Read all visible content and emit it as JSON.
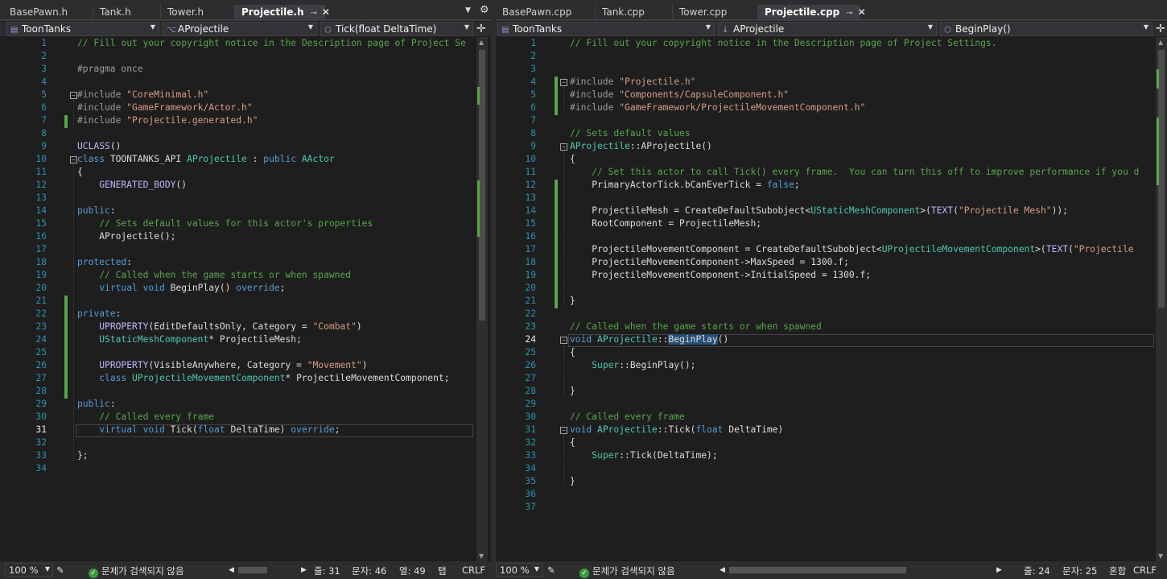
{
  "left": {
    "tabs": [
      {
        "label": "BasePawn.h",
        "active": false
      },
      {
        "label": "Tank.h",
        "active": false
      },
      {
        "label": "Tower.h",
        "active": false
      },
      {
        "label": "Projectile.h",
        "active": true
      }
    ],
    "nav": {
      "project": "ToonTanks",
      "class": "AProjectile",
      "member": "Tick(float DeltaTime)"
    },
    "status": {
      "zoom": "100 %",
      "issues": "문제가 검색되지 않음",
      "line": "줄: 31",
      "char": "문자: 46",
      "col": "열: 49",
      "indent": "탭",
      "eol": "CRLF"
    },
    "current_line": 31
  },
  "right": {
    "tabs": [
      {
        "label": "BasePawn.cpp",
        "active": false
      },
      {
        "label": "Tank.cpp",
        "active": false
      },
      {
        "label": "Tower.cpp",
        "active": false
      },
      {
        "label": "Projectile.cpp",
        "active": true
      }
    ],
    "nav": {
      "project": "ToonTanks",
      "class": "AProjectile",
      "member": "BeginPlay()"
    },
    "status": {
      "zoom": "100 %",
      "issues": "문제가 검색되지 않음",
      "line": "줄: 24",
      "char": "문자: 25",
      "indent": "혼합",
      "eol": "CRLF"
    },
    "current_line": 24
  },
  "left_code": [
    [
      [
        "cmt",
        "// Fill out your copyright notice in the Description page of Project Se"
      ]
    ],
    [],
    [
      [
        "pp",
        "#pragma once"
      ]
    ],
    [],
    [
      [
        "pp",
        "#include "
      ],
      [
        "str",
        "\"CoreMinimal.h\""
      ]
    ],
    [
      [
        "pp",
        "#include "
      ],
      [
        "str",
        "\"GameFramework/Actor.h\""
      ]
    ],
    [
      [
        "pp",
        "#include "
      ],
      [
        "str",
        "\"Projectile.generated.h\""
      ]
    ],
    [],
    [
      [
        "mac",
        "UCLASS"
      ],
      [
        "plain",
        "()"
      ]
    ],
    [
      [
        "kw",
        "class "
      ],
      [
        "plain",
        "TOONTANKS_API "
      ],
      [
        "typ",
        "AProjectile"
      ],
      [
        "plain",
        " : "
      ],
      [
        "kw",
        "public "
      ],
      [
        "typ",
        "AActor"
      ]
    ],
    [
      [
        "plain",
        "{"
      ]
    ],
    [
      [
        "plain",
        "    "
      ],
      [
        "mac",
        "GENERATED_BODY"
      ],
      [
        "plain",
        "()"
      ]
    ],
    [],
    [
      [
        "kw",
        "public"
      ],
      [
        "plain",
        ":"
      ]
    ],
    [
      [
        "plain",
        "    "
      ],
      [
        "cmt",
        "// Sets default values for this actor's properties"
      ]
    ],
    [
      [
        "plain",
        "    AProjectile();"
      ]
    ],
    [],
    [
      [
        "kw",
        "protected"
      ],
      [
        "plain",
        ":"
      ]
    ],
    [
      [
        "plain",
        "    "
      ],
      [
        "cmt",
        "// Called when the game starts or when spawned"
      ]
    ],
    [
      [
        "plain",
        "    "
      ],
      [
        "kw",
        "virtual void "
      ],
      [
        "plain",
        "BeginPlay() "
      ],
      [
        "kw",
        "override"
      ],
      [
        "plain",
        ";"
      ]
    ],
    [],
    [
      [
        "kw",
        "private"
      ],
      [
        "plain",
        ":"
      ]
    ],
    [
      [
        "plain",
        "    "
      ],
      [
        "mac",
        "UPROPERTY"
      ],
      [
        "plain",
        "(EditDefaultsOnly, Category = "
      ],
      [
        "str",
        "\"Combat\""
      ],
      [
        "plain",
        ")"
      ]
    ],
    [
      [
        "plain",
        "    "
      ],
      [
        "typ",
        "UStaticMeshComponent"
      ],
      [
        "plain",
        "* ProjectileMesh;"
      ]
    ],
    [],
    [
      [
        "plain",
        "    "
      ],
      [
        "mac",
        "UPROPERTY"
      ],
      [
        "plain",
        "(VisibleAnywhere, Category = "
      ],
      [
        "str",
        "\"Movement\""
      ],
      [
        "plain",
        ")"
      ]
    ],
    [
      [
        "plain",
        "    "
      ],
      [
        "kw",
        "class "
      ],
      [
        "typ",
        "UProjectileMovementComponent"
      ],
      [
        "plain",
        "* ProjectileMovementComponent;"
      ]
    ],
    [],
    [
      [
        "kw",
        "public"
      ],
      [
        "plain",
        ":"
      ]
    ],
    [
      [
        "plain",
        "    "
      ],
      [
        "cmt",
        "// Called every frame"
      ]
    ],
    [
      [
        "plain",
        "    "
      ],
      [
        "kw",
        "virtual void "
      ],
      [
        "plain",
        "Tick("
      ],
      [
        "kw",
        "float "
      ],
      [
        "plain",
        "DeltaTime) "
      ],
      [
        "kw",
        "override"
      ],
      [
        "plain",
        ";"
      ]
    ],
    [],
    [
      [
        "plain",
        "};"
      ]
    ],
    []
  ],
  "right_code": [
    [
      [
        "cmt",
        "// Fill out your copyright notice in the Description page of Project Settings."
      ]
    ],
    [],
    [],
    [
      [
        "pp",
        "#include "
      ],
      [
        "str",
        "\"Projectile.h\""
      ]
    ],
    [
      [
        "pp",
        "#include "
      ],
      [
        "str",
        "\"Components/CapsuleComponent.h\""
      ]
    ],
    [
      [
        "pp",
        "#include "
      ],
      [
        "str",
        "\"GameFramework/ProjectileMovementComponent.h\""
      ]
    ],
    [],
    [
      [
        "cmt",
        "// Sets default values"
      ]
    ],
    [
      [
        "typ",
        "AProjectile"
      ],
      [
        "plain",
        "::"
      ],
      [
        "plain",
        "AProjectile()"
      ]
    ],
    [
      [
        "plain",
        "{"
      ]
    ],
    [
      [
        "plain",
        "    "
      ],
      [
        "cmt",
        "// Set this actor to call Tick() every frame.  You can turn this off to improve performance if you d"
      ]
    ],
    [
      [
        "plain",
        "    PrimaryActorTick.bCanEverTick = "
      ],
      [
        "kw",
        "false"
      ],
      [
        "plain",
        ";"
      ]
    ],
    [],
    [
      [
        "plain",
        "    ProjectileMesh = CreateDefaultSubobject<"
      ],
      [
        "typ",
        "UStaticMeshComponent"
      ],
      [
        "plain",
        ">("
      ],
      [
        "mac",
        "TEXT"
      ],
      [
        "plain",
        "("
      ],
      [
        "str",
        "\"Projectile Mesh\""
      ],
      [
        "plain",
        "));"
      ]
    ],
    [
      [
        "plain",
        "    RootComponent = ProjectileMesh;"
      ]
    ],
    [],
    [
      [
        "plain",
        "    ProjectileMovementComponent = CreateDefaultSubobject<"
      ],
      [
        "typ",
        "UProjectileMovementComponent"
      ],
      [
        "plain",
        ">("
      ],
      [
        "mac",
        "TEXT"
      ],
      [
        "plain",
        "("
      ],
      [
        "str",
        "\"Projectile"
      ]
    ],
    [
      [
        "plain",
        "    ProjectileMovementComponent->MaxSpeed = 1300.f;"
      ]
    ],
    [
      [
        "plain",
        "    ProjectileMovementComponent->InitialSpeed = 1300.f;"
      ]
    ],
    [],
    [
      [
        "plain",
        "}"
      ]
    ],
    [],
    [
      [
        "cmt",
        "// Called when the game starts or when spawned"
      ]
    ],
    [
      [
        "kw",
        "void "
      ],
      [
        "typ",
        "AProjectile"
      ],
      [
        "plain",
        "::"
      ],
      [
        "sel",
        "BeginPlay"
      ],
      [
        "plain",
        "()"
      ]
    ],
    [
      [
        "plain",
        "{"
      ]
    ],
    [
      [
        "plain",
        "    "
      ],
      [
        "typ",
        "Super"
      ],
      [
        "plain",
        "::BeginPlay();"
      ]
    ],
    [],
    [
      [
        "plain",
        "}"
      ]
    ],
    [],
    [
      [
        "cmt",
        "// Called every frame"
      ]
    ],
    [
      [
        "kw",
        "void "
      ],
      [
        "typ",
        "AProjectile"
      ],
      [
        "plain",
        "::Tick("
      ],
      [
        "kw",
        "float "
      ],
      [
        "plain",
        "DeltaTime)"
      ]
    ],
    [
      [
        "plain",
        "{"
      ]
    ],
    [
      [
        "plain",
        "    "
      ],
      [
        "typ",
        "Super"
      ],
      [
        "plain",
        "::Tick(DeltaTime);"
      ]
    ],
    [],
    [
      [
        "plain",
        "}"
      ]
    ],
    [],
    []
  ]
}
